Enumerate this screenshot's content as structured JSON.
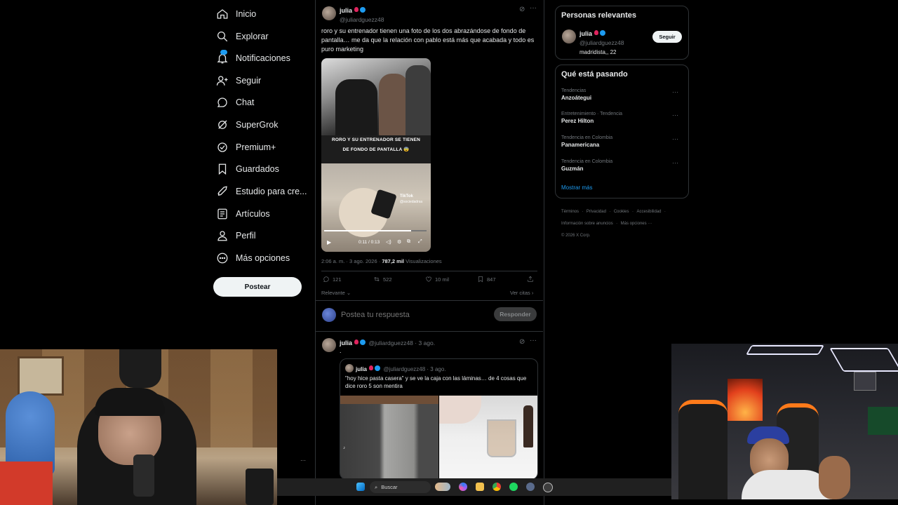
{
  "nav": {
    "items": [
      {
        "label": "Inicio",
        "icon": "home-icon"
      },
      {
        "label": "Explorar",
        "icon": "search-icon"
      },
      {
        "label": "Notificaciones",
        "icon": "bell-icon"
      },
      {
        "label": "Seguir",
        "icon": "add-user-icon"
      },
      {
        "label": "Chat",
        "icon": "chat-bubble-icon"
      },
      {
        "label": "SuperGrok",
        "icon": "grok-icon"
      },
      {
        "label": "Premium+",
        "icon": "premium-icon"
      },
      {
        "label": "Guardados",
        "icon": "bookmark-icon"
      },
      {
        "label": "Estudio para cre...",
        "icon": "rocket-icon"
      },
      {
        "label": "Artículos",
        "icon": "article-icon"
      },
      {
        "label": "Perfil",
        "icon": "person-icon"
      },
      {
        "label": "Más opciones",
        "icon": "more-circle-icon"
      }
    ],
    "post_button": "Postear"
  },
  "main_post": {
    "author": "julia",
    "handle": "@juliardguezz48",
    "text": "roro y su entrenador tienen una foto de los dos abrazándose de fondo de pantalla… me da que la relación con pablo está más que acabada y todo es puro marketing",
    "video": {
      "caption_line1": "RORO Y SU ENTRENADOR SE TIENEN",
      "caption_line2": "DE FONDO DE PANTALLA 😨",
      "watermark": "TikTok",
      "watermark_handle": "@sociedadrsa",
      "time": "0:11 / 0:13",
      "progress": 0.85
    },
    "timestamp": "2:06 a. m. · 3 ago. 2026 ·",
    "views_count": "787,2 mil",
    "views_label": "Visualizaciones",
    "replies": "121",
    "reposts": "522",
    "likes": "10 mil",
    "bookmarks": "847",
    "sort_label": "Relevante",
    "quotes_label": "Ver citas"
  },
  "reply_box": {
    "placeholder": "Postea tu respuesta",
    "button": "Responder"
  },
  "second_post": {
    "author": "julia",
    "handle": "@juliardguezz48 · 3 ago.",
    "text": ".",
    "quoted": {
      "author": "julia",
      "handle": "@juliardguezz48 · 3 ago.",
      "text": "\"hoy hice pasta casera\" y se ve la caja con las láminas… de 4 cosas que dice roro 5 son mentira"
    }
  },
  "relevant_people": {
    "title": "Personas relevantes",
    "person": {
      "name": "julia",
      "handle": "@juliardguezz48",
      "bio": "madridista,, 22",
      "follow_button": "Seguir"
    }
  },
  "trends": {
    "title": "Qué está pasando",
    "items": [
      {
        "meta": "Tendencias",
        "name": "Anzoátegui"
      },
      {
        "meta": "Entretenimiento · Tendencia",
        "name": "Perez Hilton"
      },
      {
        "meta": "Tendencia en Colombia",
        "name": "Panamericana"
      },
      {
        "meta": "Tendencia en Colombia",
        "name": "Guzmán"
      }
    ],
    "show_more": "Mostrar más"
  },
  "footer": {
    "links_line1": [
      "Términos",
      "Privacidad",
      "Cookies",
      "Accesibilidad"
    ],
    "links_line2": [
      "Información sobre anuncios",
      "Más opciones ···"
    ],
    "copyright": "© 2026 X Corp."
  },
  "taskbar": {
    "search_placeholder": "Buscar"
  },
  "colors": {
    "accent": "#1d9bf0",
    "background": "#000000",
    "text_primary": "#e7e9ea",
    "text_secondary": "#71767b",
    "border": "#2f3336"
  }
}
